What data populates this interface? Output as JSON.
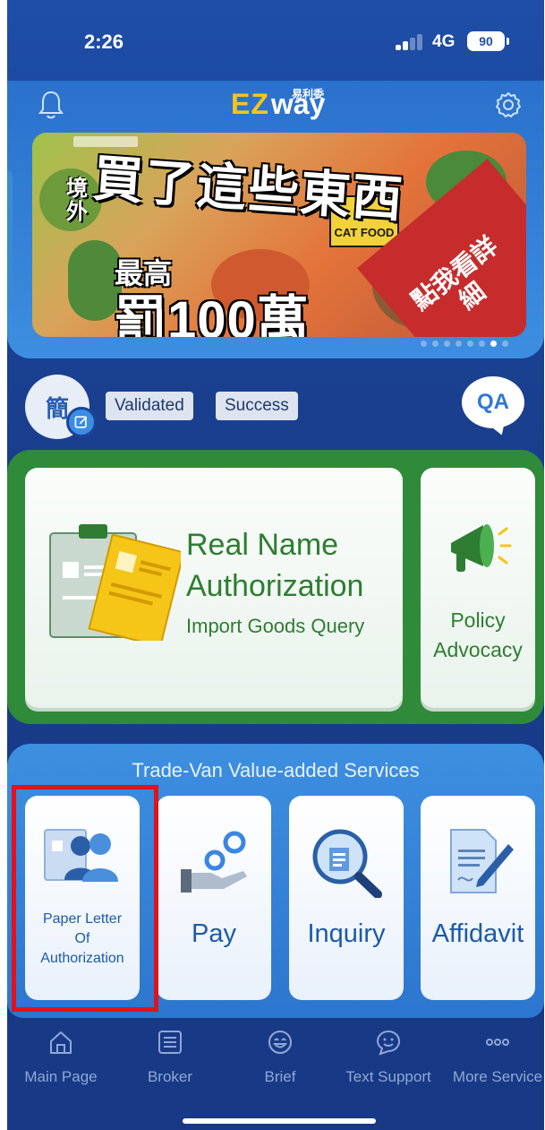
{
  "status_bar": {
    "time": "2:26",
    "network": "4G",
    "battery": "90"
  },
  "header": {
    "logo_ez": "EZ",
    "logo_way": "way",
    "logo_cn": "易利委",
    "bell_icon": "bell-icon",
    "settings_icon": "gear-icon"
  },
  "banner": {
    "side_text": "境外",
    "headline": "買了這些東西",
    "sub": "最高",
    "penalty": "罰100萬",
    "cta": "點我看詳細",
    "product_label": "CAT FOOD",
    "dots_total": 8,
    "dots_active": 7
  },
  "user_row": {
    "avatar_text": "簡",
    "status_1": "Validated",
    "status_2": "Success",
    "qa_label": "QA"
  },
  "main_cards": {
    "real_name": {
      "line1": "Real Name",
      "line2": "Authorization",
      "sub": "Import Goods Query"
    },
    "policy": {
      "line1": "Policy",
      "line2": "Advocacy"
    }
  },
  "services": {
    "title": "Trade-Van Value-added Services",
    "items": [
      {
        "label1": "Paper Letter",
        "label2": "Of",
        "label3": "Authorization"
      },
      {
        "label": "Pay"
      },
      {
        "label": "Inquiry"
      },
      {
        "label": "Affidavit"
      }
    ]
  },
  "bottom_nav": [
    {
      "label": "Main Page",
      "icon": "home-icon"
    },
    {
      "label": "Broker",
      "icon": "list-icon"
    },
    {
      "label": "Brief",
      "icon": "smile-icon"
    },
    {
      "label": "Text Support",
      "icon": "chat-smile-icon"
    },
    {
      "label": "More Service",
      "icon": "more-dots-icon"
    }
  ],
  "colors": {
    "background": "#1a3f8f",
    "header": "#2a71cc",
    "green_panel": "#2f8a3a",
    "green_text": "#2e7d32",
    "service_text": "#1d5aa8",
    "highlight": "#e0121b"
  }
}
